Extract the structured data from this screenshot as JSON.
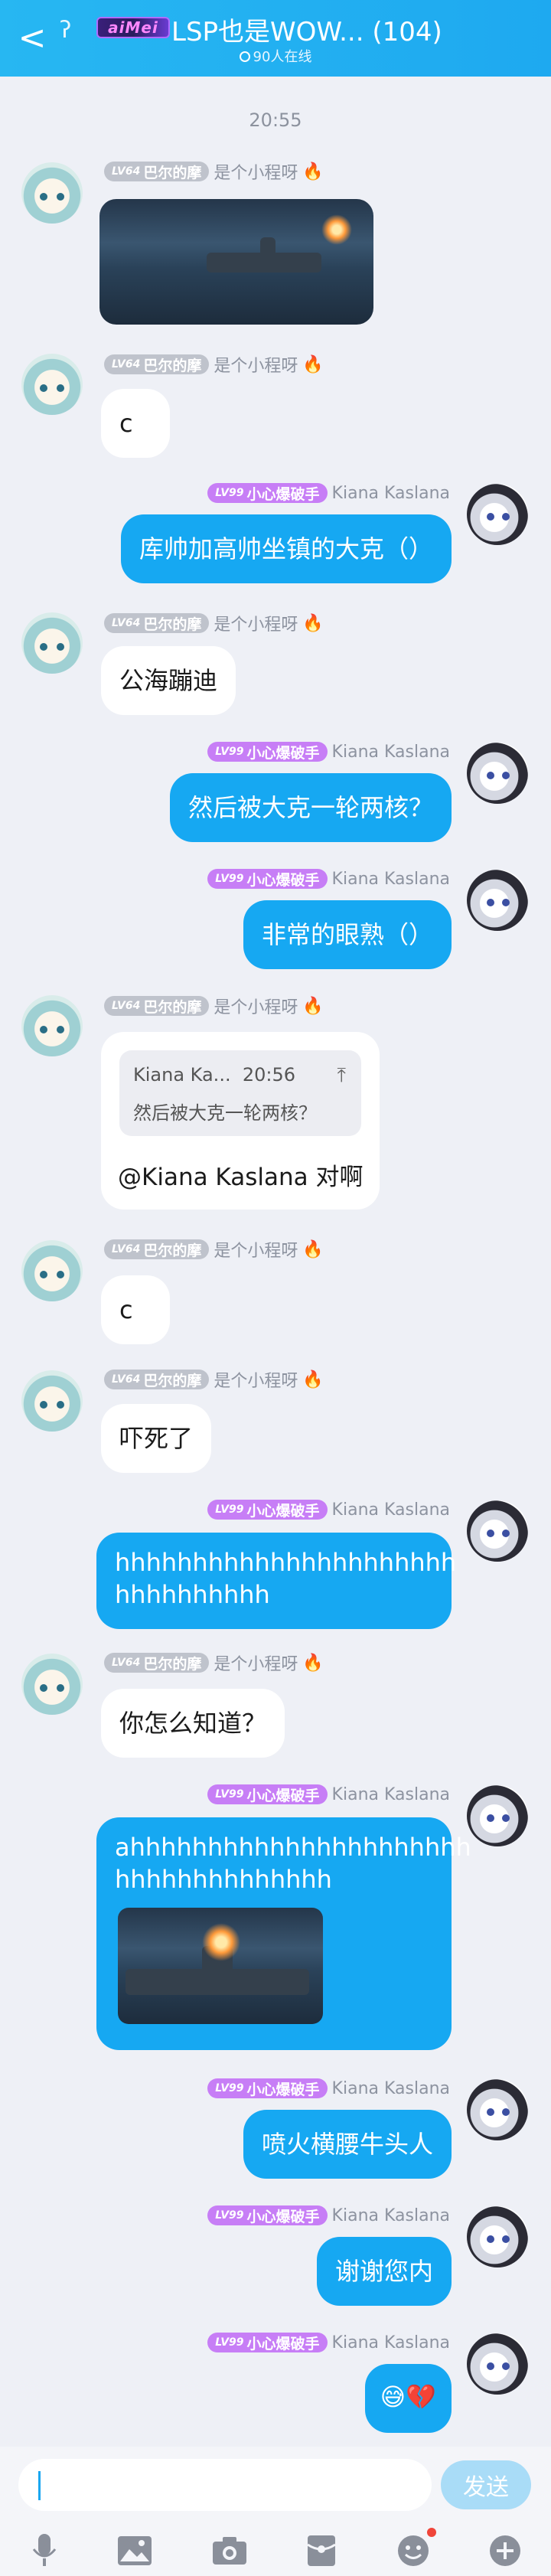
{
  "header": {
    "back_glyph": "<",
    "ear_glyph": "ʔ",
    "group_badge": "aiMei",
    "title": "LSP也是WOW...  (104)",
    "online": "90人在线"
  },
  "time_stamp": "20:55",
  "users": {
    "left": {
      "level": "LV64",
      "title": "巴尔的摩",
      "name": "是个小程呀",
      "badge_color": "#bfc3cc"
    },
    "right": {
      "level": "LV99",
      "title": "小心爆破手",
      "name": "Kiana  Kaslana",
      "badge_color": "#c77ef6"
    }
  },
  "messages": [
    {
      "side": "left",
      "type": "image",
      "image_icon": "warship-screenshot"
    },
    {
      "side": "left",
      "type": "text",
      "text": "c"
    },
    {
      "side": "right",
      "type": "text",
      "text": "库帅加高帅坐镇的大克（）"
    },
    {
      "side": "left",
      "type": "text",
      "text": "公海蹦迪"
    },
    {
      "side": "right",
      "type": "text",
      "text": "然后被大克一轮两核？"
    },
    {
      "side": "right",
      "type": "text",
      "text": "非常的眼熟（）"
    },
    {
      "side": "left",
      "type": "reply",
      "quote_author": "Kiana  Ka...",
      "quote_time": "20:56",
      "quote_text": "然后被大克一轮两核？",
      "text": "@Kiana  Kaslana 对啊"
    },
    {
      "side": "left",
      "type": "text",
      "text": "c"
    },
    {
      "side": "left",
      "type": "text",
      "text": "吓死了"
    },
    {
      "side": "right",
      "type": "text",
      "lines": [
        "hhhhhhhhhhhhhhhhhhhhhh",
        "hhhhhhhhhh"
      ]
    },
    {
      "side": "left",
      "type": "text",
      "text": "你怎么知道？"
    },
    {
      "side": "right",
      "type": "text_image",
      "lines": [
        "ahhhhhhhhhhhhhhhhhhhhhh",
        "hhhhhhhhhhhhhh"
      ],
      "image_icon": "warship-screenshot"
    },
    {
      "side": "right",
      "type": "text",
      "text": "喷火横腰牛头人"
    },
    {
      "side": "right",
      "type": "text",
      "text": "谢谢您内"
    },
    {
      "side": "right",
      "type": "emoji",
      "text": "😅💔"
    }
  ],
  "input": {
    "placeholder": "",
    "send_label": "发送"
  },
  "toolbar": [
    "mic-icon",
    "image-icon",
    "camera-icon",
    "red-packet-icon",
    "emoji-icon",
    "plus-icon"
  ],
  "colors": {
    "header": "#1ea9f0",
    "bubble_right": "#16a8f2",
    "bubble_left": "#ffffff",
    "background": "#eef0f6"
  }
}
